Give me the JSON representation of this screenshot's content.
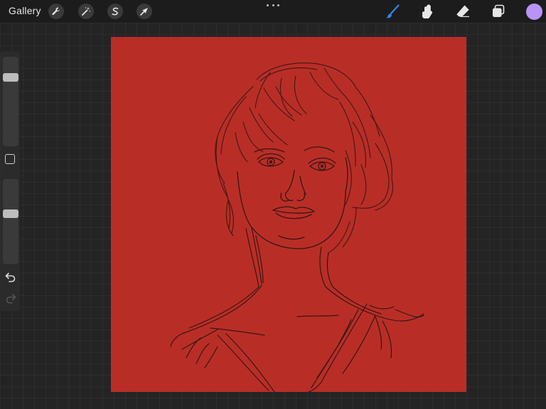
{
  "toolbar": {
    "gallery_label": "Gallery",
    "left_tools": [
      {
        "name": "actions",
        "icon": "wrench-icon"
      },
      {
        "name": "adjustments",
        "icon": "magic-wand-icon"
      },
      {
        "name": "selection",
        "icon": "selection-s-icon"
      },
      {
        "name": "transform",
        "icon": "arrow-cursor-icon"
      }
    ],
    "more_icon": "ellipsis-icon",
    "right_tools": [
      {
        "name": "brush",
        "icon": "brush-icon",
        "active": true
      },
      {
        "name": "smudge",
        "icon": "smudge-finger-icon",
        "active": false
      },
      {
        "name": "eraser",
        "icon": "eraser-icon",
        "active": false
      },
      {
        "name": "layers",
        "icon": "layers-icon",
        "active": false
      }
    ],
    "current_color": "#b993f5",
    "active_color": "#2f86f5"
  },
  "sidebar": {
    "brush_size_level": 0.8,
    "opacity_level": 0.6,
    "modify_icon": "square-modify-icon",
    "undo_icon": "undo-arrow-icon",
    "redo_icon": "redo-arrow-icon"
  },
  "canvas": {
    "background_color": "#b82e27",
    "stroke_color": "#3a1512",
    "subject": "sketch-portrait"
  }
}
